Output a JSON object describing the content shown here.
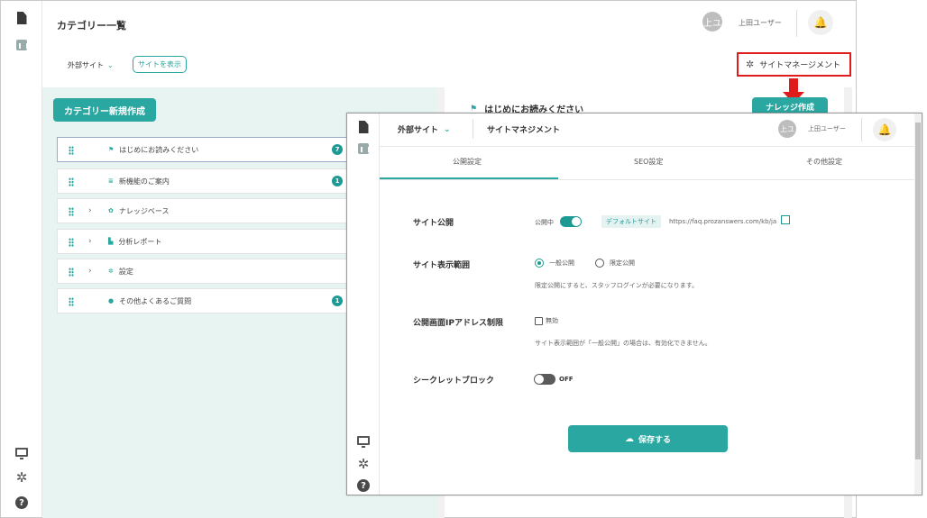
{
  "back": {
    "title": "カテゴリー一覧",
    "site_selector": "外部サイト",
    "view_site_button": "サイトを表示",
    "user_avatar": "上ユ",
    "user_name": "上田ユーザー",
    "site_management_link": "サイトマネージメント",
    "new_category_button": "カテゴリー新規作成",
    "categories": [
      {
        "label": "はじめにお読みください",
        "badge": "7",
        "icon": "flag-icon"
      },
      {
        "label": "新機能のご案内",
        "badge": "1",
        "icon": "list-icon"
      },
      {
        "label": "ナレッジベース",
        "badge": "",
        "icon": "gear-icon"
      },
      {
        "label": "分析レポート",
        "badge": "",
        "icon": "chart-icon"
      },
      {
        "label": "設定",
        "badge": "",
        "icon": "gear-icon"
      },
      {
        "label": "その他よくあるご質問",
        "badge": "1",
        "icon": "help-icon"
      }
    ],
    "right_panel_title": "はじめにお読みください",
    "knowledge_create_button": "ナレッジ作成"
  },
  "front": {
    "site_selector": "外部サイト",
    "page_title": "サイトマネジメント",
    "user_avatar": "上ユ",
    "user_name": "上田ユーザー",
    "tabs": [
      "公開設定",
      "SEO設定",
      "その他設定"
    ],
    "publish": {
      "label": "サイト公開",
      "status": "公開中",
      "default_site_tag": "デフォルトサイト",
      "url": "https://faq.prozanswers.com/kb/ja"
    },
    "scope": {
      "label": "サイト表示範囲",
      "option_public": "一般公開",
      "option_limited": "限定公開",
      "hint": "限定公開にすると、スタッフログインが必要になります。"
    },
    "ip_restriction": {
      "label": "公開画面IPアドレス制限",
      "checkbox_label": "無効",
      "hint": "サイト表示範囲が「一般公開」の場合は、有効化できません。"
    },
    "secret_block": {
      "label": "シークレットブロック",
      "state": "OFF"
    },
    "save_button": "保存する"
  },
  "colors": {
    "accent": "#2aa7a0",
    "highlight": "#e01b1b",
    "arrow": "#e01b1b"
  }
}
